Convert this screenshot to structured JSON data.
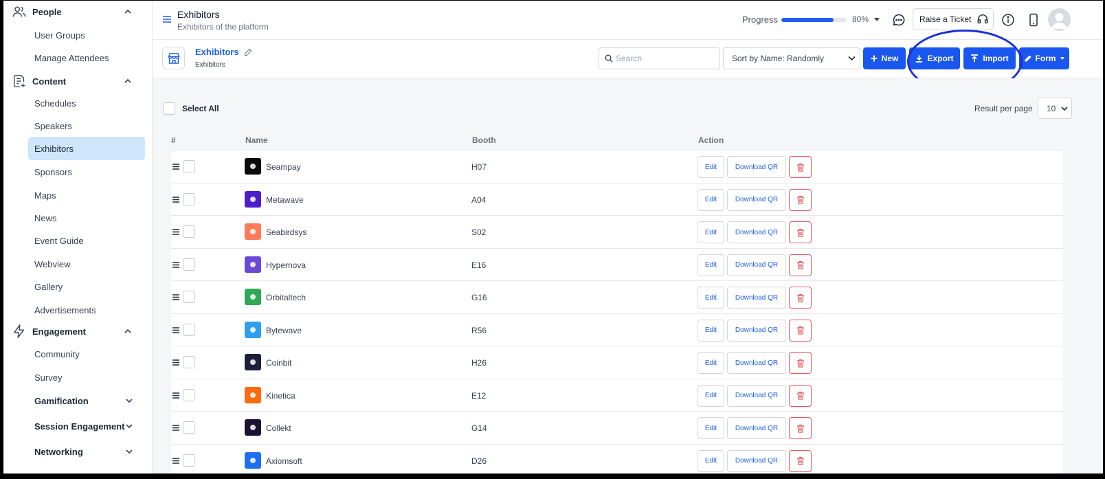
{
  "sidebar": {
    "sections": [
      {
        "label": "People",
        "items": [
          "User Groups",
          "Manage Attendees"
        ]
      },
      {
        "label": "Content",
        "items": [
          "Schedules",
          "Speakers",
          "Exhibitors",
          "Sponsors",
          "Maps",
          "News",
          "Event Guide",
          "Webview",
          "Gallery",
          "Advertisements"
        ]
      },
      {
        "label": "Engagement",
        "items": [
          "Community",
          "Survey"
        ]
      }
    ],
    "collapsible_groups": [
      "Gamification",
      "Session Engagement",
      "Networking"
    ],
    "active_item": "Exhibitors"
  },
  "header": {
    "title": "Exhibitors",
    "subtitle": "Exhibitors of the platform",
    "progress_label": "Progress",
    "progress_percent": 80,
    "progress_text": "80%",
    "ticket_label": "Raise a Ticket"
  },
  "subheader": {
    "title": "Exhibitors",
    "breadcrumb": "Exhibitors",
    "search_placeholder": "Search",
    "sort_label": "Sort by Name: Randomly",
    "new_label": "New",
    "export_label": "Export",
    "import_label": "Import",
    "form_label": "Form"
  },
  "list": {
    "select_all_label": "Select All",
    "result_per_page_label": "Result per page",
    "result_per_page_value": "10",
    "columns": [
      "#",
      "Name",
      "Booth",
      "Action"
    ],
    "edit_label": "Edit",
    "qr_label": "Download QR",
    "rows": [
      {
        "name": "Seampay",
        "booth": "H07",
        "logo_color": "#0b0b0b"
      },
      {
        "name": "Metawave",
        "booth": "A04",
        "logo_color": "#4c1ccf"
      },
      {
        "name": "Seabirdsys",
        "booth": "S02",
        "logo_color": "#ff7a59"
      },
      {
        "name": "Hypernova",
        "booth": "E16",
        "logo_color": "#6b48d6"
      },
      {
        "name": "Orbitaltech",
        "booth": "G16",
        "logo_color": "#2eaa55"
      },
      {
        "name": "Bytewave",
        "booth": "R56",
        "logo_color": "#2e9ef0"
      },
      {
        "name": "Coinbit",
        "booth": "H26",
        "logo_color": "#1c1f3a"
      },
      {
        "name": "Kinetica",
        "booth": "E12",
        "logo_color": "#ff6a13"
      },
      {
        "name": "Collekt",
        "booth": "G14",
        "logo_color": "#1a1233"
      },
      {
        "name": "Axiomsoft",
        "booth": "D26",
        "logo_color": "#1c6ef2"
      }
    ]
  },
  "colors": {
    "accent": "#1a56f0",
    "active_bg": "#cde6fb",
    "danger": "#e35d5d",
    "highlight_ring": "#1d2fd4"
  }
}
